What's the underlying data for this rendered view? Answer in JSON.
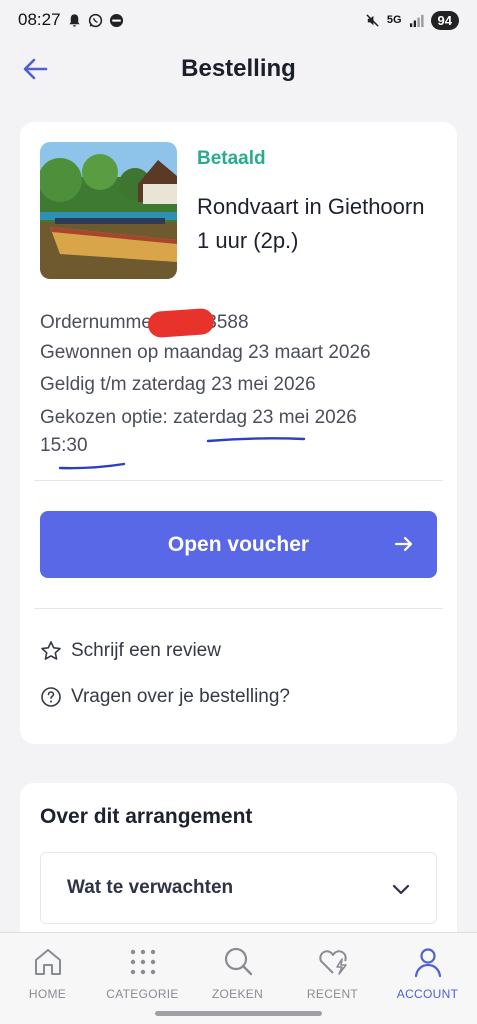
{
  "status_bar": {
    "time": "08:27",
    "network": "5G",
    "battery": "94"
  },
  "app_bar": {
    "title": "Bestelling"
  },
  "order": {
    "status": "Betaald",
    "product_title": "Rondvaart in Giethoorn 1 uur (2p.)",
    "order_number_label": "Ordernummer",
    "order_number_visible_suffix": "3588",
    "won_on": "Gewonnen op maandag 23 maart 2026",
    "valid_until": "Geldig t/m zaterdag 23 mei 2026",
    "chosen_option": "Gekozen optie: zaterdag 23 mei 2026",
    "chosen_time": "15:30",
    "voucher_button": "Open voucher",
    "review_link": "Schrijf een review",
    "questions_link": "Vragen over je bestelling?"
  },
  "about": {
    "title": "Over dit arrangement",
    "expander_label": "Wat te verwachten"
  },
  "bottom_nav": {
    "items": [
      {
        "label": "HOME",
        "icon": "home-icon",
        "active": false
      },
      {
        "label": "CATEGORIE",
        "icon": "grid-icon",
        "active": false
      },
      {
        "label": "ZOEKEN",
        "icon": "search-icon",
        "active": false
      },
      {
        "label": "RECENT",
        "icon": "heart-flash-icon",
        "active": false
      },
      {
        "label": "ACCOUNT",
        "icon": "person-icon",
        "active": true
      }
    ]
  },
  "colors": {
    "accent": "#5868e6",
    "paid_status": "#2aab8e",
    "nav_active": "#4f5fd6",
    "redaction": "#e8322c",
    "pen_underline": "#2b3fbf"
  }
}
